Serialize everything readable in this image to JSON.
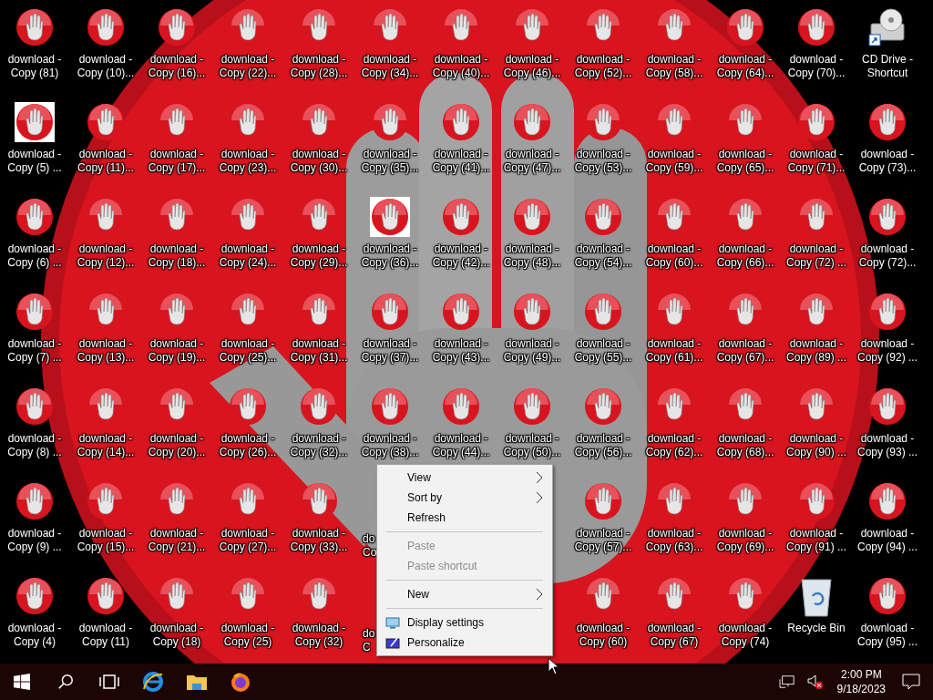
{
  "desktop": {
    "icons": [
      {
        "kind": "file",
        "label": "download - Copy (81)"
      },
      {
        "kind": "file",
        "label": "download - Copy (10)..."
      },
      {
        "kind": "file",
        "label": "download - Copy (16)..."
      },
      {
        "kind": "file",
        "label": "download - Copy (22)..."
      },
      {
        "kind": "file",
        "label": "download - Copy (28)..."
      },
      {
        "kind": "file",
        "label": "download - Copy (34)..."
      },
      {
        "kind": "file",
        "label": "download - Copy (40)..."
      },
      {
        "kind": "file",
        "label": "download - Copy (46)..."
      },
      {
        "kind": "file",
        "label": "download - Copy (52)..."
      },
      {
        "kind": "file",
        "label": "download - Copy (58)..."
      },
      {
        "kind": "file",
        "label": "download - Copy (64)..."
      },
      {
        "kind": "file",
        "label": "download - Copy (70)..."
      },
      {
        "kind": "cd",
        "label": "CD Drive - Shortcut"
      },
      {
        "kind": "thumb",
        "label": "download - Copy (5) ..."
      },
      {
        "kind": "file",
        "label": "download - Copy (11)..."
      },
      {
        "kind": "file",
        "label": "download - Copy (17)..."
      },
      {
        "kind": "file",
        "label": "download - Copy (23)..."
      },
      {
        "kind": "file",
        "label": "download - Copy (30)..."
      },
      {
        "kind": "file",
        "label": "download - Copy (35)..."
      },
      {
        "kind": "file",
        "label": "download - Copy (41)..."
      },
      {
        "kind": "file",
        "label": "download - Copy (47)..."
      },
      {
        "kind": "file",
        "label": "download - Copy (53)..."
      },
      {
        "kind": "file",
        "label": "download - Copy (59)..."
      },
      {
        "kind": "file",
        "label": "download - Copy (65)..."
      },
      {
        "kind": "file",
        "label": "download - Copy (71)..."
      },
      {
        "kind": "file",
        "label": "download - Copy (73)..."
      },
      {
        "kind": "file",
        "label": "download - Copy (6) ..."
      },
      {
        "kind": "file",
        "label": "download - Copy (12)..."
      },
      {
        "kind": "file",
        "label": "download - Copy (18)..."
      },
      {
        "kind": "file",
        "label": "download - Copy (24)..."
      },
      {
        "kind": "file",
        "label": "download - Copy (29)..."
      },
      {
        "kind": "thumb",
        "label": "download - Copy (36)..."
      },
      {
        "kind": "file",
        "label": "download - Copy (42)..."
      },
      {
        "kind": "file",
        "label": "download - Copy (48)..."
      },
      {
        "kind": "file",
        "label": "download - Copy (54)..."
      },
      {
        "kind": "file",
        "label": "download - Copy (60)..."
      },
      {
        "kind": "file",
        "label": "download - Copy (66)..."
      },
      {
        "kind": "file",
        "label": "download - Copy (72) ..."
      },
      {
        "kind": "file",
        "label": "download - Copy (72)..."
      },
      {
        "kind": "file",
        "label": "download - Copy (7) ..."
      },
      {
        "kind": "file",
        "label": "download - Copy (13)..."
      },
      {
        "kind": "file",
        "label": "download - Copy (19)..."
      },
      {
        "kind": "file",
        "label": "download - Copy (25)..."
      },
      {
        "kind": "file",
        "label": "download - Copy (31)..."
      },
      {
        "kind": "file",
        "label": "download - Copy (37)..."
      },
      {
        "kind": "file",
        "label": "download - Copy (43)..."
      },
      {
        "kind": "file",
        "label": "download - Copy (49)..."
      },
      {
        "kind": "file",
        "label": "download - Copy (55)..."
      },
      {
        "kind": "file",
        "label": "download - Copy (61)..."
      },
      {
        "kind": "file",
        "label": "download - Copy (67)..."
      },
      {
        "kind": "file",
        "label": "download - Copy (89) ..."
      },
      {
        "kind": "file",
        "label": "download - Copy (92) ..."
      },
      {
        "kind": "file",
        "label": "download - Copy (8) ..."
      },
      {
        "kind": "file",
        "label": "download - Copy (14)..."
      },
      {
        "kind": "file",
        "label": "download - Copy (20)..."
      },
      {
        "kind": "file",
        "label": "download - Copy (26)..."
      },
      {
        "kind": "file",
        "label": "download - Copy (32)..."
      },
      {
        "kind": "file",
        "label": "download - Copy (38)..."
      },
      {
        "kind": "file",
        "label": "download - Copy (44)..."
      },
      {
        "kind": "file",
        "label": "download - Copy (50)..."
      },
      {
        "kind": "file",
        "label": "download - Copy (56)..."
      },
      {
        "kind": "file",
        "label": "download - Copy (62)..."
      },
      {
        "kind": "file",
        "label": "download - Copy (68)..."
      },
      {
        "kind": "file",
        "label": "download - Copy (90) ..."
      },
      {
        "kind": "file",
        "label": "download - Copy (93) ..."
      },
      {
        "kind": "file",
        "label": "download - Copy (9) ..."
      },
      {
        "kind": "file",
        "label": "download - Copy (15)..."
      },
      {
        "kind": "file",
        "label": "download - Copy (21)..."
      },
      {
        "kind": "file",
        "label": "download - Copy (27)..."
      },
      {
        "kind": "file",
        "label": "download - Copy (33)..."
      },
      {
        "kind": "partial",
        "label": "do Co"
      },
      {
        "kind": "covered"
      },
      {
        "kind": "covered"
      },
      {
        "kind": "file",
        "label": "download - Copy (57)..."
      },
      {
        "kind": "file",
        "label": "download - Copy (63)..."
      },
      {
        "kind": "file",
        "label": "download - Copy (69)..."
      },
      {
        "kind": "file",
        "label": "download - Copy (91) ..."
      },
      {
        "kind": "file",
        "label": "download - Copy (94) ..."
      },
      {
        "kind": "file",
        "label": "download - Copy (4)"
      },
      {
        "kind": "file",
        "label": "download - Copy (11)"
      },
      {
        "kind": "file",
        "label": "download - Copy (18)"
      },
      {
        "kind": "file",
        "label": "download - Copy (25)"
      },
      {
        "kind": "file",
        "label": "download - Copy (32)"
      },
      {
        "kind": "partial",
        "label": "do C"
      },
      {
        "kind": "covered"
      },
      {
        "kind": "covered"
      },
      {
        "kind": "file",
        "label": "download - Copy (60)"
      },
      {
        "kind": "file",
        "label": "download - Copy (67)"
      },
      {
        "kind": "file",
        "label": "download - Copy (74)"
      },
      {
        "kind": "bin",
        "label": "Recycle Bin"
      },
      {
        "kind": "file",
        "label": "download - Copy (95) ..."
      }
    ]
  },
  "context_menu": {
    "items": [
      {
        "kind": "item",
        "label": "View",
        "submenu": true,
        "disabled": false
      },
      {
        "kind": "item",
        "label": "Sort by",
        "submenu": true,
        "disabled": false
      },
      {
        "kind": "item",
        "label": "Refresh",
        "submenu": false,
        "disabled": false
      },
      {
        "kind": "separator"
      },
      {
        "kind": "item",
        "label": "Paste",
        "submenu": false,
        "disabled": true
      },
      {
        "kind": "item",
        "label": "Paste shortcut",
        "submenu": false,
        "disabled": true
      },
      {
        "kind": "separator"
      },
      {
        "kind": "item",
        "label": "New",
        "submenu": true,
        "disabled": false
      },
      {
        "kind": "separator"
      },
      {
        "kind": "display",
        "label": "Display settings",
        "submenu": false,
        "disabled": false
      },
      {
        "kind": "personalize",
        "label": "Personalize",
        "submenu": false,
        "disabled": false
      }
    ]
  },
  "taskbar": {
    "tray": {
      "time": "2:00 PM",
      "date": "9/18/2023"
    }
  }
}
